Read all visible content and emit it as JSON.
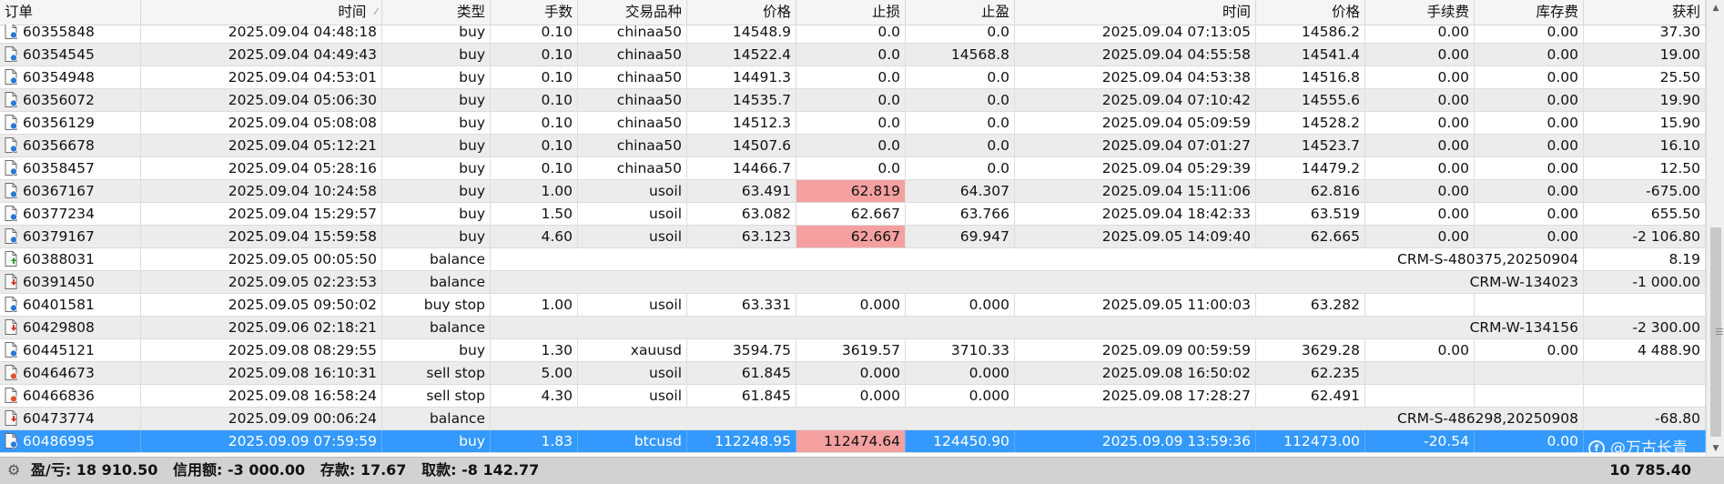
{
  "columns": [
    "订单",
    "时间",
    "类型",
    "手数",
    "交易品种",
    "价格",
    "止损",
    "止盈",
    "时间",
    "价格",
    "手续费",
    "库存费",
    "获利"
  ],
  "rows": [
    {
      "order": "60355848",
      "open_time": "2025.09.04 04:48:18",
      "type": "buy",
      "volume": "0.10",
      "symbol": "chinaa50",
      "open_price": "14548.9",
      "sl": "0.0",
      "tp": "0.0",
      "close_time": "2025.09.04 07:13:05",
      "close_price": "14586.2",
      "commission": "0.00",
      "swap": "0.00",
      "profit": "37.30",
      "icon": "buy-order-icon",
      "sl_highlight": false
    },
    {
      "order": "60354545",
      "open_time": "2025.09.04 04:49:43",
      "type": "buy",
      "volume": "0.10",
      "symbol": "chinaa50",
      "open_price": "14522.4",
      "sl": "0.0",
      "tp": "14568.8",
      "close_time": "2025.09.04 04:55:58",
      "close_price": "14541.4",
      "commission": "0.00",
      "swap": "0.00",
      "profit": "19.00",
      "icon": "buy-order-icon",
      "sl_highlight": false
    },
    {
      "order": "60354948",
      "open_time": "2025.09.04 04:53:01",
      "type": "buy",
      "volume": "0.10",
      "symbol": "chinaa50",
      "open_price": "14491.3",
      "sl": "0.0",
      "tp": "0.0",
      "close_time": "2025.09.04 04:53:38",
      "close_price": "14516.8",
      "commission": "0.00",
      "swap": "0.00",
      "profit": "25.50",
      "icon": "buy-order-icon",
      "sl_highlight": false
    },
    {
      "order": "60356072",
      "open_time": "2025.09.04 05:06:30",
      "type": "buy",
      "volume": "0.10",
      "symbol": "chinaa50",
      "open_price": "14535.7",
      "sl": "0.0",
      "tp": "0.0",
      "close_time": "2025.09.04 07:10:42",
      "close_price": "14555.6",
      "commission": "0.00",
      "swap": "0.00",
      "profit": "19.90",
      "icon": "buy-order-icon",
      "sl_highlight": false
    },
    {
      "order": "60356129",
      "open_time": "2025.09.04 05:08:08",
      "type": "buy",
      "volume": "0.10",
      "symbol": "chinaa50",
      "open_price": "14512.3",
      "sl": "0.0",
      "tp": "0.0",
      "close_time": "2025.09.04 05:09:59",
      "close_price": "14528.2",
      "commission": "0.00",
      "swap": "0.00",
      "profit": "15.90",
      "icon": "buy-order-icon",
      "sl_highlight": false
    },
    {
      "order": "60356678",
      "open_time": "2025.09.04 05:12:21",
      "type": "buy",
      "volume": "0.10",
      "symbol": "chinaa50",
      "open_price": "14507.6",
      "sl": "0.0",
      "tp": "0.0",
      "close_time": "2025.09.04 07:01:27",
      "close_price": "14523.7",
      "commission": "0.00",
      "swap": "0.00",
      "profit": "16.10",
      "icon": "buy-order-icon",
      "sl_highlight": false
    },
    {
      "order": "60358457",
      "open_time": "2025.09.04 05:28:16",
      "type": "buy",
      "volume": "0.10",
      "symbol": "chinaa50",
      "open_price": "14466.7",
      "sl": "0.0",
      "tp": "0.0",
      "close_time": "2025.09.04 05:29:39",
      "close_price": "14479.2",
      "commission": "0.00",
      "swap": "0.00",
      "profit": "12.50",
      "icon": "buy-order-icon",
      "sl_highlight": false
    },
    {
      "order": "60367167",
      "open_time": "2025.09.04 10:24:58",
      "type": "buy",
      "volume": "1.00",
      "symbol": "usoil",
      "open_price": "63.491",
      "sl": "62.819",
      "tp": "64.307",
      "close_time": "2025.09.04 15:11:06",
      "close_price": "62.816",
      "commission": "0.00",
      "swap": "0.00",
      "profit": "-675.00",
      "icon": "buy-order-icon",
      "sl_highlight": true
    },
    {
      "order": "60377234",
      "open_time": "2025.09.04 15:29:57",
      "type": "buy",
      "volume": "1.50",
      "symbol": "usoil",
      "open_price": "63.082",
      "sl": "62.667",
      "tp": "63.766",
      "close_time": "2025.09.04 18:42:33",
      "close_price": "63.519",
      "commission": "0.00",
      "swap": "0.00",
      "profit": "655.50",
      "icon": "buy-order-icon",
      "sl_highlight": false
    },
    {
      "order": "60379167",
      "open_time": "2025.09.04 15:59:58",
      "type": "buy",
      "volume": "4.60",
      "symbol": "usoil",
      "open_price": "63.123",
      "sl": "62.667",
      "tp": "69.947",
      "close_time": "2025.09.05 14:09:40",
      "close_price": "62.665",
      "commission": "0.00",
      "swap": "0.00",
      "profit": "-2 106.80",
      "icon": "buy-order-icon",
      "sl_highlight": true
    },
    {
      "order": "60388031",
      "open_time": "2025.09.05 00:05:50",
      "type": "balance",
      "comment": "CRM-S-480375,20250904",
      "profit": "8.19",
      "icon": "deposit-icon"
    },
    {
      "order": "60391450",
      "open_time": "2025.09.05 02:23:53",
      "type": "balance",
      "comment": "CRM-W-134023",
      "profit": "-1 000.00",
      "icon": "withdrawal-icon"
    },
    {
      "order": "60401581",
      "open_time": "2025.09.05 09:50:02",
      "type": "buy stop",
      "volume": "1.00",
      "symbol": "usoil",
      "open_price": "63.331",
      "sl": "0.000",
      "tp": "0.000",
      "close_time": "2025.09.05 11:00:03",
      "close_price": "63.282",
      "commission": "",
      "swap": "",
      "profit": "",
      "icon": "pending-order-icon",
      "sl_highlight": false
    },
    {
      "order": "60429808",
      "open_time": "2025.09.06 02:18:21",
      "type": "balance",
      "comment": "CRM-W-134156",
      "profit": "-2 300.00",
      "icon": "withdrawal-icon"
    },
    {
      "order": "60445121",
      "open_time": "2025.09.08 08:29:55",
      "type": "buy",
      "volume": "1.30",
      "symbol": "xauusd",
      "open_price": "3594.75",
      "sl": "3619.57",
      "tp": "3710.33",
      "close_time": "2025.09.09 00:59:59",
      "close_price": "3629.28",
      "commission": "0.00",
      "swap": "0.00",
      "profit": "4 488.90",
      "icon": "buy-order-icon",
      "sl_highlight": false
    },
    {
      "order": "60464673",
      "open_time": "2025.09.08 16:10:31",
      "type": "sell stop",
      "volume": "5.00",
      "symbol": "usoil",
      "open_price": "61.845",
      "sl": "0.000",
      "tp": "0.000",
      "close_time": "2025.09.08 16:50:02",
      "close_price": "62.235",
      "commission": "",
      "swap": "",
      "profit": "",
      "icon": "sell-order-icon",
      "sl_highlight": false
    },
    {
      "order": "60466836",
      "open_time": "2025.09.08 16:58:24",
      "type": "sell stop",
      "volume": "4.30",
      "symbol": "usoil",
      "open_price": "61.845",
      "sl": "0.000",
      "tp": "0.000",
      "close_time": "2025.09.08 17:28:27",
      "close_price": "62.491",
      "commission": "",
      "swap": "",
      "profit": "",
      "icon": "sell-order-icon",
      "sl_highlight": false
    },
    {
      "order": "60473774",
      "open_time": "2025.09.09 00:06:24",
      "type": "balance",
      "comment": "CRM-S-486298,20250908",
      "profit": "-68.80",
      "icon": "withdrawal-icon"
    },
    {
      "order": "60486995",
      "open_time": "2025.09.09 07:59:59",
      "type": "buy",
      "volume": "1.83",
      "symbol": "btcusd",
      "open_price": "112248.95",
      "sl": "112474.64",
      "tp": "124450.90",
      "close_time": "2025.09.09 13:59:36",
      "close_price": "112473.00",
      "commission": "-20.54",
      "swap": "0.00",
      "profit": "",
      "icon": "buy-order-icon",
      "sl_highlight": true,
      "selected": true
    }
  ],
  "footer": {
    "pl_label": "盈/亏:",
    "pl_value": "18 910.50",
    "credit_label": "信用额:",
    "credit_value": "-3 000.00",
    "deposit_label": "存款:",
    "deposit_value": "17.67",
    "withdraw_label": "取款:",
    "withdraw_value": "-8 142.77",
    "total": "10 785.40"
  },
  "watermark": {
    "text": "@万古长青"
  },
  "colors": {
    "selected": "#3399ff",
    "stoploss_highlight": "#f5a0a0",
    "alt_row": "#ececec"
  }
}
